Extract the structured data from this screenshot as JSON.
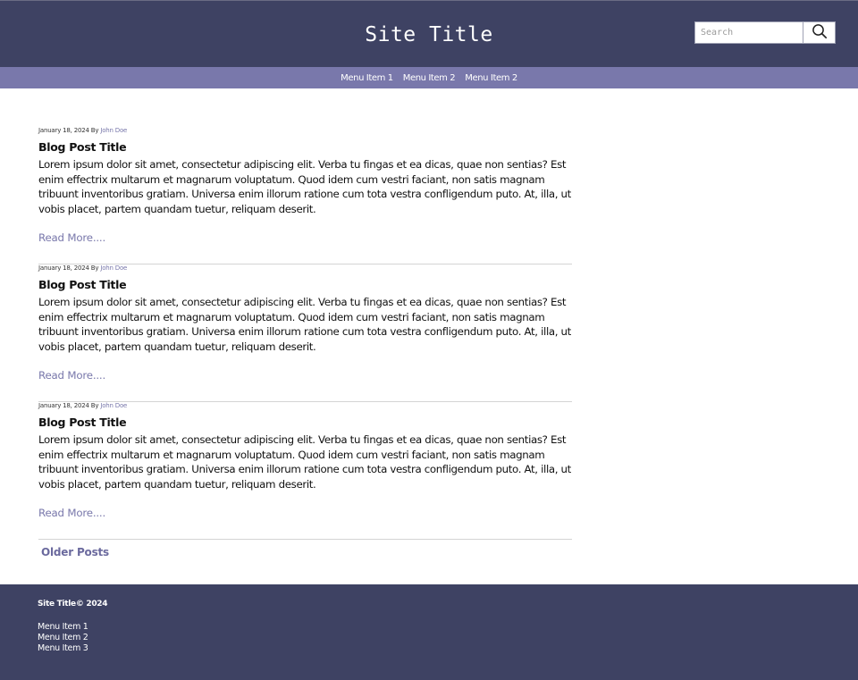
{
  "header": {
    "site_title": "Site Title",
    "search": {
      "placeholder": "Search",
      "value": ""
    },
    "search_icon": "search-icon"
  },
  "nav": {
    "items": [
      {
        "label": "Menu Item 1"
      },
      {
        "label": "Menu Item 2"
      },
      {
        "label": "Menu Item 2"
      }
    ]
  },
  "posts": [
    {
      "date": "January 18, 2024",
      "by": "By",
      "author": "John Doe",
      "title": "Blog Post Title",
      "body": "Lorem ipsum dolor sit amet, consectetur adipiscing elit. Verba tu fingas et ea dicas, quae non sentias? Est enim effectrix multarum et magnarum voluptatum. Quod idem cum vestri faciant, non satis magnam tribuunt inventoribus gratiam. Universa enim illorum ratione cum tota vestra confligendum puto. At, illa, ut vobis placet, partem quandam tuetur, reliquam deserit.",
      "read_more": "Read More...."
    },
    {
      "date": "January 18, 2024",
      "by": "By",
      "author": "John Doe",
      "title": "Blog Post Title",
      "body": "Lorem ipsum dolor sit amet, consectetur adipiscing elit. Verba tu fingas et ea dicas, quae non sentias? Est enim effectrix multarum et magnarum voluptatum. Quod idem cum vestri faciant, non satis magnam tribuunt inventoribus gratiam. Universa enim illorum ratione cum tota vestra confligendum puto. At, illa, ut vobis placet, partem quandam tuetur, reliquam deserit.",
      "read_more": "Read More...."
    },
    {
      "date": "January 18, 2024",
      "by": "By",
      "author": "John Doe",
      "title": "Blog Post Title",
      "body": "Lorem ipsum dolor sit amet, consectetur adipiscing elit. Verba tu fingas et ea dicas, quae non sentias? Est enim effectrix multarum et magnarum voluptatum. Quod idem cum vestri faciant, non satis magnam tribuunt inventoribus gratiam. Universa enim illorum ratione cum tota vestra confligendum puto. At, illa, ut vobis placet, partem quandam tuetur, reliquam deserit.",
      "read_more": "Read More...."
    }
  ],
  "pagination": {
    "older_posts": "Older Posts"
  },
  "footer": {
    "copyright": "Site Title© 2024",
    "menu": [
      {
        "label": "Menu Item 1"
      },
      {
        "label": "Menu Item 2"
      },
      {
        "label": "Menu Item 3"
      }
    ]
  },
  "colors": {
    "header_bg": "#3e4263",
    "nav_bg": "#7978ab",
    "accent": "#7978ab",
    "footer_bg": "#3e4263"
  }
}
